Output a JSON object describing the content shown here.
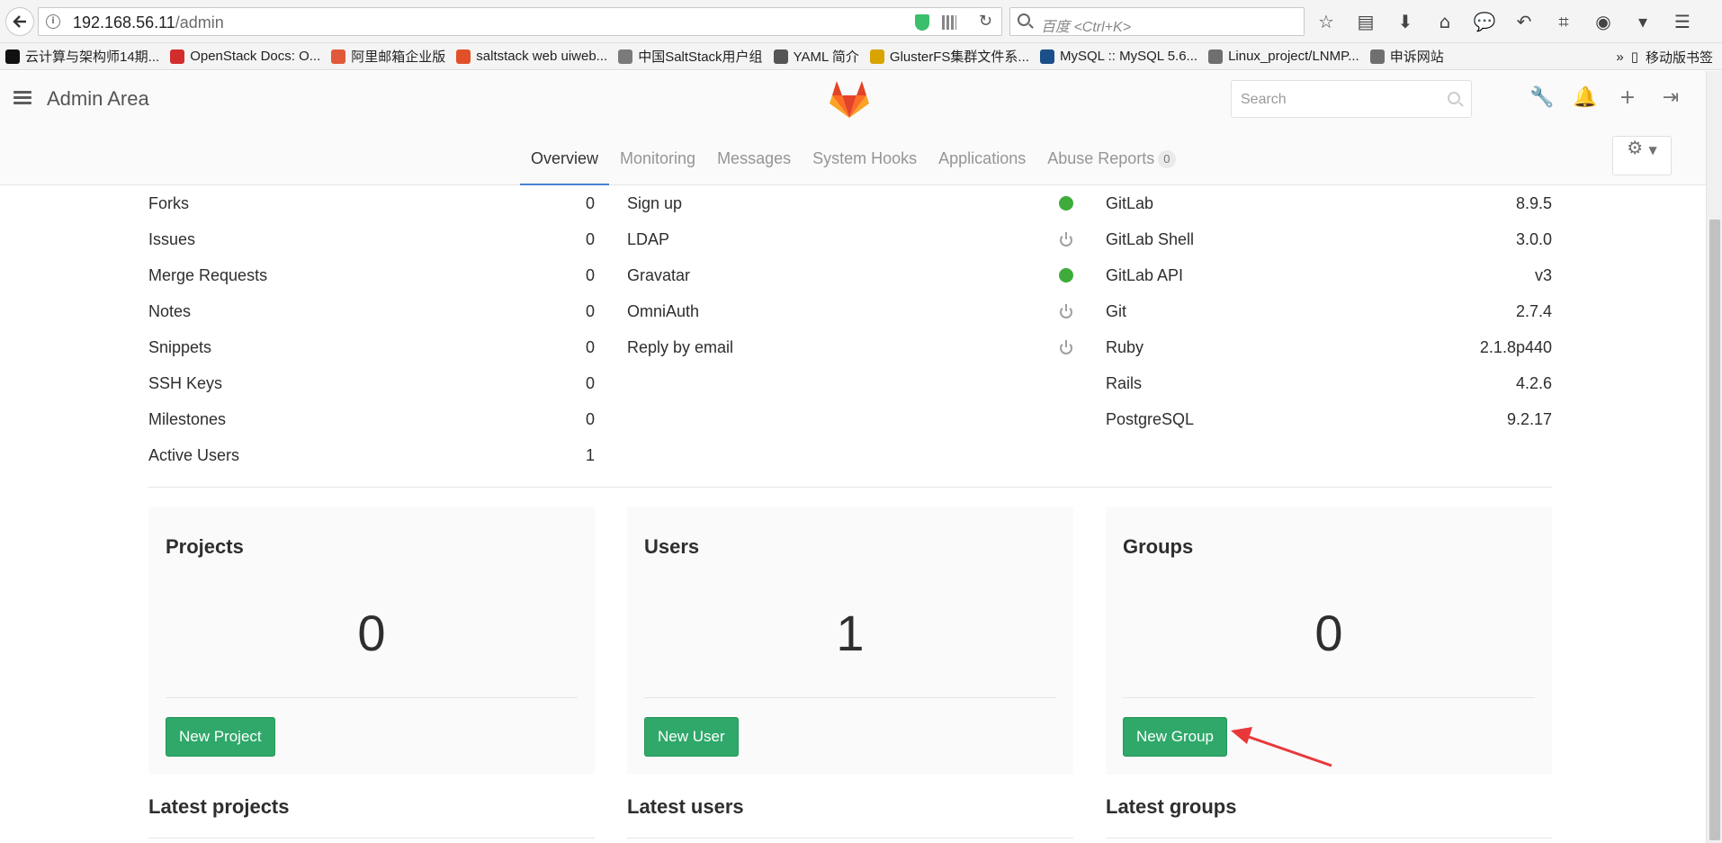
{
  "browser": {
    "url_host": "192.168.56.11",
    "url_path": "/admin",
    "search_placeholder": "百度 <Ctrl+K>",
    "bookmarks": [
      {
        "label": "云计算与架构师14期...",
        "color": "#111111"
      },
      {
        "label": "OpenStack Docs: O...",
        "color": "#d22d2d"
      },
      {
        "label": "阿里邮箱企业版",
        "color": "#e05a3a"
      },
      {
        "label": "saltstack web uiweb...",
        "color": "#e2502a"
      },
      {
        "label": "中国SaltStack用户组",
        "color": "#7a7a7a"
      },
      {
        "label": "YAML 简介",
        "color": "#555555"
      },
      {
        "label": "GlusterFS集群文件系...",
        "color": "#d9a400"
      },
      {
        "label": "MySQL :: MySQL 5.6...",
        "color": "#1b4f8a"
      },
      {
        "label": "Linux_project/LNMP...",
        "color": "#6f6f6f"
      },
      {
        "label": "申诉网站",
        "color": "#6f6f6f"
      }
    ],
    "bookmarks_more": "»",
    "mobile_bookmarks": "移动版书签"
  },
  "header": {
    "title": "Admin Area",
    "search_placeholder": "Search"
  },
  "tabs": [
    {
      "label": "Overview",
      "active": true
    },
    {
      "label": "Monitoring",
      "active": false
    },
    {
      "label": "Messages",
      "active": false
    },
    {
      "label": "System Hooks",
      "active": false
    },
    {
      "label": "Applications",
      "active": false
    },
    {
      "label": "Abuse Reports",
      "active": false,
      "badge": "0"
    }
  ],
  "stats": [
    {
      "label": "Forks",
      "value": "0"
    },
    {
      "label": "Issues",
      "value": "0"
    },
    {
      "label": "Merge Requests",
      "value": "0"
    },
    {
      "label": "Notes",
      "value": "0"
    },
    {
      "label": "Snippets",
      "value": "0"
    },
    {
      "label": "SSH Keys",
      "value": "0"
    },
    {
      "label": "Milestones",
      "value": "0"
    },
    {
      "label": "Active Users",
      "value": "1"
    }
  ],
  "features": [
    {
      "label": "Sign up",
      "status": "on"
    },
    {
      "label": "LDAP",
      "status": "off"
    },
    {
      "label": "Gravatar",
      "status": "on"
    },
    {
      "label": "OmniAuth",
      "status": "off"
    },
    {
      "label": "Reply by email",
      "status": "off"
    }
  ],
  "components": [
    {
      "label": "GitLab",
      "value": "8.9.5"
    },
    {
      "label": "GitLab Shell",
      "value": "3.0.0"
    },
    {
      "label": "GitLab API",
      "value": "v3"
    },
    {
      "label": "Git",
      "value": "2.7.4"
    },
    {
      "label": "Ruby",
      "value": "2.1.8p440"
    },
    {
      "label": "Rails",
      "value": "4.2.6"
    },
    {
      "label": "PostgreSQL",
      "value": "9.2.17"
    }
  ],
  "cards": {
    "projects": {
      "title": "Projects",
      "count": "0",
      "button": "New Project"
    },
    "users": {
      "title": "Users",
      "count": "1",
      "button": "New User"
    },
    "groups": {
      "title": "Groups",
      "count": "0",
      "button": "New Group"
    }
  },
  "latest": {
    "projects": "Latest projects",
    "users": "Latest users",
    "groups": "Latest groups"
  },
  "colors": {
    "accent_tab": "#4a7fd4",
    "button_green": "#2fa86a",
    "status_on": "#3fab3b",
    "annotation_arrow": "#e8383a"
  }
}
